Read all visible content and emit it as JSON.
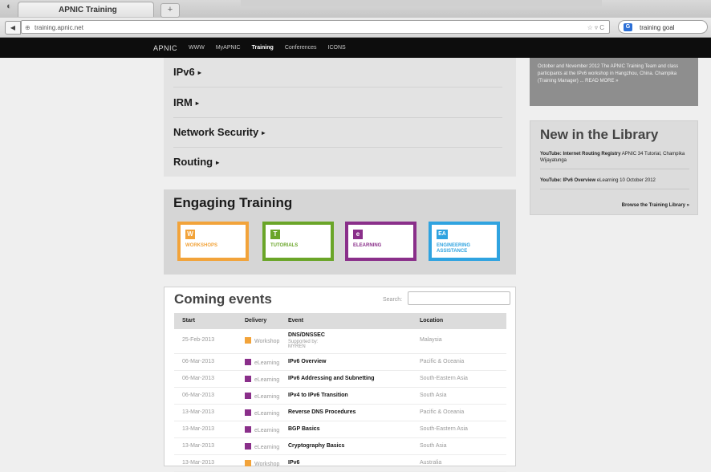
{
  "browser": {
    "tab_title": "APNIC Training",
    "new_tab": "+",
    "url": "training.apnic.net",
    "url_icons": "☆ ▿ C",
    "search_text": "training goal",
    "search_engine_letter": "G"
  },
  "site_nav": {
    "logo": "APNIC",
    "items": [
      "WWW",
      "MyAPNIC",
      "Training",
      "Conferences",
      "ICONS"
    ]
  },
  "topics": [
    {
      "label": "IPv6",
      "arrow": "▸"
    },
    {
      "label": "IRM",
      "arrow": "▸"
    },
    {
      "label": "Network Security",
      "arrow": "▸"
    },
    {
      "label": "Routing",
      "arrow": "▸"
    }
  ],
  "engaging": {
    "title": "Engaging Training",
    "tiles": [
      {
        "letter": "W",
        "label": "WORKSHOPS",
        "color": "#f2a33a"
      },
      {
        "letter": "T",
        "label": "TUTORIALS",
        "color": "#6aa528"
      },
      {
        "letter": "e",
        "label": "ELEARNING",
        "color": "#8a2f8a"
      },
      {
        "letter": "EA",
        "label": "ENGINEERING ASSISTANCE",
        "color": "#2fa3e0"
      }
    ]
  },
  "events": {
    "title": "Coming events",
    "search_label": "Search:",
    "search_value": "",
    "columns": [
      "Start",
      "Delivery",
      "Event",
      "Location"
    ],
    "rows": [
      {
        "start": "25-Feb-2013",
        "delivery": "Workshop",
        "delivery_color": "#f2a33a",
        "event": "DNS/DNSSEC",
        "sub": "Supported by: MYREN",
        "location": "Malaysia"
      },
      {
        "start": "06-Mar-2013",
        "delivery": "eLearning",
        "delivery_color": "#8a2f8a",
        "event": "IPv6 Overview",
        "sub": "",
        "location": "Pacific & Oceania"
      },
      {
        "start": "06-Mar-2013",
        "delivery": "eLearning",
        "delivery_color": "#8a2f8a",
        "event": "IPv6 Addressing and Subnetting",
        "sub": "",
        "location": "South-Eastern Asia"
      },
      {
        "start": "06-Mar-2013",
        "delivery": "eLearning",
        "delivery_color": "#8a2f8a",
        "event": "IPv4 to IPv6 Transition",
        "sub": "",
        "location": "South Asia"
      },
      {
        "start": "13-Mar-2013",
        "delivery": "eLearning",
        "delivery_color": "#8a2f8a",
        "event": "Reverse DNS Procedures",
        "sub": "",
        "location": "Pacific & Oceania"
      },
      {
        "start": "13-Mar-2013",
        "delivery": "eLearning",
        "delivery_color": "#8a2f8a",
        "event": "BGP Basics",
        "sub": "",
        "location": "South-Eastern Asia"
      },
      {
        "start": "13-Mar-2013",
        "delivery": "eLearning",
        "delivery_color": "#8a2f8a",
        "event": "Cryptography Basics",
        "sub": "",
        "location": "South Asia"
      },
      {
        "start": "13-Mar-2013",
        "delivery": "Workshop",
        "delivery_color": "#f2a33a",
        "event": "IPv6",
        "sub": "",
        "location": "Australia"
      }
    ]
  },
  "news": {
    "text": "October and November 2012 The APNIC Training Team and class participants at the IPv6 workshop in Hangzhou, China. Champika (Training Manager) ... READ MORE »"
  },
  "library": {
    "title": "New in the Library",
    "items": [
      {
        "bold": "YouTube: Internet Routing Registry",
        "rest": " APNIC 34 Tutorial, Champika Wijayatunga"
      },
      {
        "bold": "YouTube: IPv6 Overview",
        "rest": " eLearning 10 October 2012"
      }
    ],
    "browse": "Browse the Training Library »"
  }
}
